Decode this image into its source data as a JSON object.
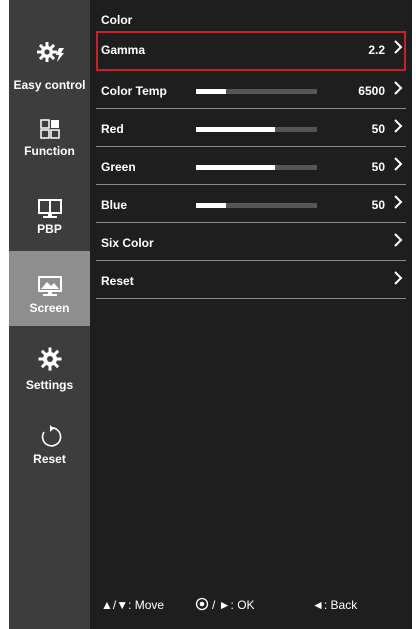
{
  "sidebar": {
    "items": [
      {
        "label": "Easy control",
        "icon": "easy-control-icon"
      },
      {
        "label": "Function",
        "icon": "function-icon"
      },
      {
        "label": "PBP",
        "icon": "pbp-icon"
      },
      {
        "label": "Screen",
        "icon": "screen-icon",
        "selected": true
      },
      {
        "label": "Settings",
        "icon": "settings-icon"
      },
      {
        "label": "Reset",
        "icon": "reset-icon"
      }
    ]
  },
  "panel": {
    "title": "Color",
    "rows": [
      {
        "label": "Gamma",
        "value": "2.2"
      },
      {
        "label": "Color Temp",
        "value": "6500",
        "level": 0.25
      },
      {
        "label": "Red",
        "value": "50",
        "level": 0.65
      },
      {
        "label": "Green",
        "value": "50",
        "level": 0.65
      },
      {
        "label": "Blue",
        "value": "50",
        "level": 0.25
      },
      {
        "label": "Six Color",
        "value": ""
      },
      {
        "label": "Reset",
        "value": ""
      }
    ]
  },
  "footer": {
    "move": "▲/▼: Move",
    "ok": "/ ►: OK",
    "back": "◄: Back"
  },
  "colors": {
    "highlight": "#c8202a",
    "sidebar_bg": "#3d3d3d",
    "sidebar_selected": "#8e8e8e",
    "panel_bg": "#1e1e1e"
  }
}
